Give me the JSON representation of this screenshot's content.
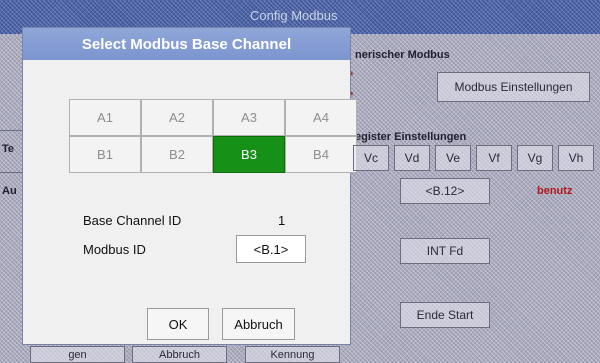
{
  "background": {
    "title": "Config Modbus",
    "section1": "nerischer Modbus",
    "modbus_settings": "Modbus Einstellungen",
    "section2": "egister Einstellungen",
    "value_buttons": [
      "Vc",
      "Vd",
      "Ve",
      "Vf",
      "Vg",
      "Vh"
    ],
    "field_b12": "<B.12>",
    "label_benutz": "benutz",
    "field_int": "INT Fd",
    "field_start": "Ende Start",
    "footer_left": "gen",
    "footer_mid": "Abbruch",
    "footer_right": "Kennung",
    "side_te": "Te",
    "side_au": "Au"
  },
  "dialog": {
    "title": "Select Modbus Base Channel",
    "channels": [
      {
        "label": "A1",
        "selected": false
      },
      {
        "label": "A2",
        "selected": false
      },
      {
        "label": "A3",
        "selected": false
      },
      {
        "label": "A4",
        "selected": false
      },
      {
        "label": "B1",
        "selected": false
      },
      {
        "label": "B2",
        "selected": false
      },
      {
        "label": "B3",
        "selected": true
      },
      {
        "label": "B4",
        "selected": false
      }
    ],
    "base_channel_id_label": "Base Channel ID",
    "base_channel_id_value": "1",
    "modbus_id_label": "Modbus ID",
    "modbus_id_value": "<B.1>",
    "ok_label": "OK",
    "cancel_label": "Abbruch"
  },
  "colors": {
    "selected": "#179018",
    "title_bar": "#8fa6d8"
  }
}
